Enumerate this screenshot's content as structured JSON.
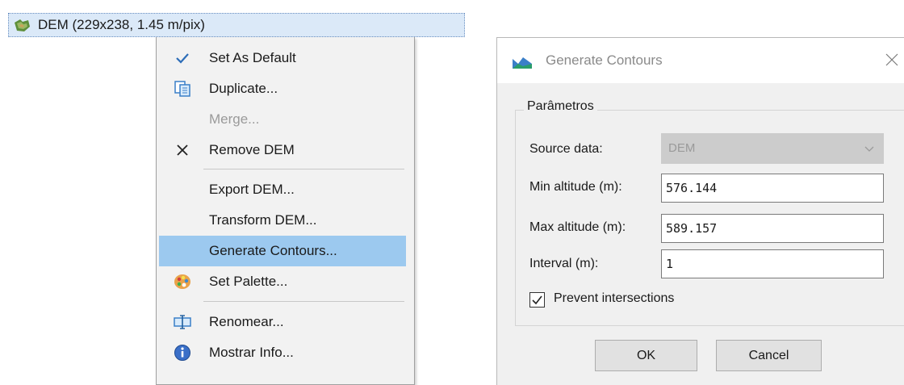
{
  "tree": {
    "item_label": "DEM (229x238, 1.45 m/pix)",
    "icon": "dem-layer-icon"
  },
  "context_menu": {
    "items": [
      {
        "label": "Set As Default",
        "icon": "checkmark-icon",
        "state": "checked"
      },
      {
        "label": "Duplicate...",
        "icon": "duplicate-icon"
      },
      {
        "label": "Merge...",
        "icon": "none",
        "state": "disabled"
      },
      {
        "label": "Remove DEM",
        "icon": "close-x-icon"
      },
      {
        "label": "Export DEM...",
        "icon": "none"
      },
      {
        "label": "Transform DEM...",
        "icon": "none"
      },
      {
        "label": "Generate Contours...",
        "icon": "none",
        "state": "highlighted"
      },
      {
        "label": "Set Palette...",
        "icon": "palette-icon"
      },
      {
        "label": "Renomear...",
        "icon": "rename-icon"
      },
      {
        "label": "Mostrar Info...",
        "icon": "info-icon"
      }
    ]
  },
  "dialog": {
    "title": "Generate Contours",
    "group_title": "Parâmetros",
    "source_label": "Source data:",
    "source_value": "DEM",
    "min_label": "Min altitude (m):",
    "min_value": "576.144",
    "max_label": "Max altitude (m):",
    "max_value": "589.157",
    "interval_label": "Interval (m):",
    "interval_value": "1",
    "prevent_label": "Prevent intersections",
    "prevent_checked": true,
    "ok_label": "OK",
    "cancel_label": "Cancel"
  },
  "colors": {
    "highlight": "#9cc9ef",
    "tree_selection": "#dbe9f8",
    "dialog_bg": "#f0f0f0"
  }
}
